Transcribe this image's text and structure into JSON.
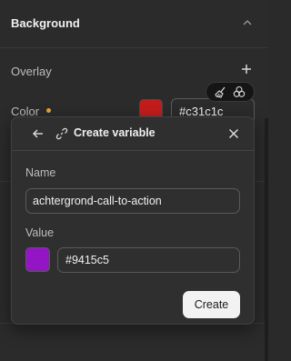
{
  "panel": {
    "section_title": "Background",
    "overlay_label": "Overlay",
    "color_label": "Color",
    "color_hex": "#c31c1c",
    "swatch_color": "#c31c1c",
    "modified_dot_color": "#e8a33a",
    "icons": {
      "collapse": "chevron-up-icon",
      "add": "plus-icon",
      "clear": "broom-icon",
      "variables": "variables-icon"
    }
  },
  "popup": {
    "title": "Create variable",
    "name_label": "Name",
    "name_value": "achtergrond-call-to-action",
    "value_label": "Value",
    "value_hex": "#9415c5",
    "swatch_color": "#9415c5",
    "create_label": "Create",
    "icons": {
      "back": "arrow-left-icon",
      "link": "link-icon",
      "close": "close-icon"
    }
  }
}
